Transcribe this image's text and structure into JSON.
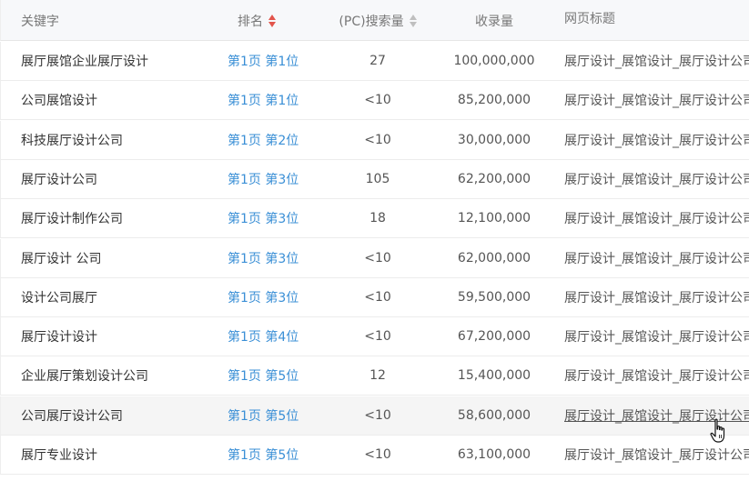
{
  "header": {
    "keyword": "关键字",
    "rank": "排名",
    "search_volume": "(PC)搜索量",
    "indexed": "收录量",
    "page_title": "网页标题"
  },
  "rows": [
    {
      "keyword": "展厅展馆企业展厅设计",
      "rank": "第1页 第1位",
      "search": "27",
      "indexed": "100,000,000",
      "title": "展厅设计_展馆设计_展厅设计公司"
    },
    {
      "keyword": "公司展馆设计",
      "rank": "第1页 第1位",
      "search": "<10",
      "indexed": "85,200,000",
      "title": "展厅设计_展馆设计_展厅设计公司"
    },
    {
      "keyword": "科技展厅设计公司",
      "rank": "第1页 第2位",
      "search": "<10",
      "indexed": "30,000,000",
      "title": "展厅设计_展馆设计_展厅设计公司"
    },
    {
      "keyword": "展厅设计公司",
      "rank": "第1页 第3位",
      "search": "105",
      "indexed": "62,200,000",
      "title": "展厅设计_展馆设计_展厅设计公司"
    },
    {
      "keyword": "展厅设计制作公司",
      "rank": "第1页 第3位",
      "search": "18",
      "indexed": "12,100,000",
      "title": "展厅设计_展馆设计_展厅设计公司"
    },
    {
      "keyword": "展厅设计 公司",
      "rank": "第1页 第3位",
      "search": "<10",
      "indexed": "62,000,000",
      "title": "展厅设计_展馆设计_展厅设计公司"
    },
    {
      "keyword": "设计公司展厅",
      "rank": "第1页 第3位",
      "search": "<10",
      "indexed": "59,500,000",
      "title": "展厅设计_展馆设计_展厅设计公司"
    },
    {
      "keyword": "展厅设计设计",
      "rank": "第1页 第4位",
      "search": "<10",
      "indexed": "67,200,000",
      "title": "展厅设计_展馆设计_展厅设计公司"
    },
    {
      "keyword": "企业展厅策划设计公司",
      "rank": "第1页 第5位",
      "search": "12",
      "indexed": "15,400,000",
      "title": "展厅设计_展馆设计_展厅设计公司"
    },
    {
      "keyword": "公司展厅设计公司",
      "rank": "第1页 第5位",
      "search": "<10",
      "indexed": "58,600,000",
      "title": "展厅设计_展馆设计_展厅设计公司"
    },
    {
      "keyword": "展厅专业设计",
      "rank": "第1页 第5位",
      "search": "<10",
      "indexed": "63,100,000",
      "title": "展厅设计_展馆设计_展厅设计公司"
    }
  ],
  "colors": {
    "link": "#3a8fd6",
    "sort_active": "#e2544b",
    "sort_inactive": "#bfbfbf",
    "header_bg": "#f7f8fa",
    "hover_bg": "#f5f5f5"
  },
  "icons": {
    "rank_sort": "sort-arrows-icon",
    "search_sort": "sort-arrows-icon",
    "cursor": "hand-pointer-icon"
  },
  "state": {
    "active_sort_column": "rank",
    "hovered_row_index": 9
  }
}
